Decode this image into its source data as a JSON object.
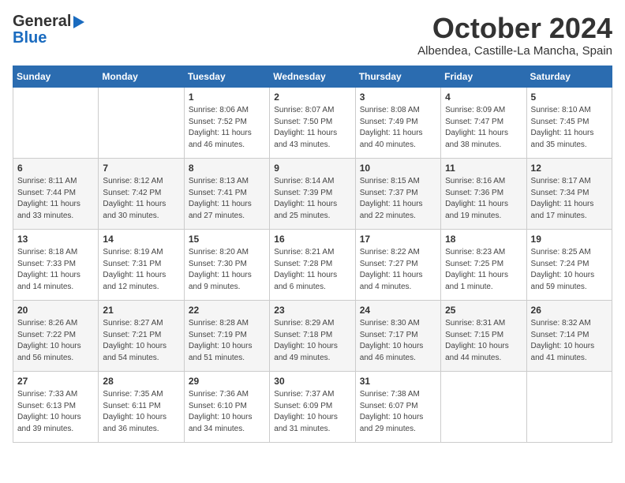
{
  "header": {
    "logo_general": "General",
    "logo_blue": "Blue",
    "month_title": "October 2024",
    "location": "Albendea, Castille-La Mancha, Spain"
  },
  "days_of_week": [
    "Sunday",
    "Monday",
    "Tuesday",
    "Wednesday",
    "Thursday",
    "Friday",
    "Saturday"
  ],
  "weeks": [
    [
      {
        "day": "",
        "info": ""
      },
      {
        "day": "",
        "info": ""
      },
      {
        "day": "1",
        "info": "Sunrise: 8:06 AM\nSunset: 7:52 PM\nDaylight: 11 hours and 46 minutes."
      },
      {
        "day": "2",
        "info": "Sunrise: 8:07 AM\nSunset: 7:50 PM\nDaylight: 11 hours and 43 minutes."
      },
      {
        "day": "3",
        "info": "Sunrise: 8:08 AM\nSunset: 7:49 PM\nDaylight: 11 hours and 40 minutes."
      },
      {
        "day": "4",
        "info": "Sunrise: 8:09 AM\nSunset: 7:47 PM\nDaylight: 11 hours and 38 minutes."
      },
      {
        "day": "5",
        "info": "Sunrise: 8:10 AM\nSunset: 7:45 PM\nDaylight: 11 hours and 35 minutes."
      }
    ],
    [
      {
        "day": "6",
        "info": "Sunrise: 8:11 AM\nSunset: 7:44 PM\nDaylight: 11 hours and 33 minutes."
      },
      {
        "day": "7",
        "info": "Sunrise: 8:12 AM\nSunset: 7:42 PM\nDaylight: 11 hours and 30 minutes."
      },
      {
        "day": "8",
        "info": "Sunrise: 8:13 AM\nSunset: 7:41 PM\nDaylight: 11 hours and 27 minutes."
      },
      {
        "day": "9",
        "info": "Sunrise: 8:14 AM\nSunset: 7:39 PM\nDaylight: 11 hours and 25 minutes."
      },
      {
        "day": "10",
        "info": "Sunrise: 8:15 AM\nSunset: 7:37 PM\nDaylight: 11 hours and 22 minutes."
      },
      {
        "day": "11",
        "info": "Sunrise: 8:16 AM\nSunset: 7:36 PM\nDaylight: 11 hours and 19 minutes."
      },
      {
        "day": "12",
        "info": "Sunrise: 8:17 AM\nSunset: 7:34 PM\nDaylight: 11 hours and 17 minutes."
      }
    ],
    [
      {
        "day": "13",
        "info": "Sunrise: 8:18 AM\nSunset: 7:33 PM\nDaylight: 11 hours and 14 minutes."
      },
      {
        "day": "14",
        "info": "Sunrise: 8:19 AM\nSunset: 7:31 PM\nDaylight: 11 hours and 12 minutes."
      },
      {
        "day": "15",
        "info": "Sunrise: 8:20 AM\nSunset: 7:30 PM\nDaylight: 11 hours and 9 minutes."
      },
      {
        "day": "16",
        "info": "Sunrise: 8:21 AM\nSunset: 7:28 PM\nDaylight: 11 hours and 6 minutes."
      },
      {
        "day": "17",
        "info": "Sunrise: 8:22 AM\nSunset: 7:27 PM\nDaylight: 11 hours and 4 minutes."
      },
      {
        "day": "18",
        "info": "Sunrise: 8:23 AM\nSunset: 7:25 PM\nDaylight: 11 hours and 1 minute."
      },
      {
        "day": "19",
        "info": "Sunrise: 8:25 AM\nSunset: 7:24 PM\nDaylight: 10 hours and 59 minutes."
      }
    ],
    [
      {
        "day": "20",
        "info": "Sunrise: 8:26 AM\nSunset: 7:22 PM\nDaylight: 10 hours and 56 minutes."
      },
      {
        "day": "21",
        "info": "Sunrise: 8:27 AM\nSunset: 7:21 PM\nDaylight: 10 hours and 54 minutes."
      },
      {
        "day": "22",
        "info": "Sunrise: 8:28 AM\nSunset: 7:19 PM\nDaylight: 10 hours and 51 minutes."
      },
      {
        "day": "23",
        "info": "Sunrise: 8:29 AM\nSunset: 7:18 PM\nDaylight: 10 hours and 49 minutes."
      },
      {
        "day": "24",
        "info": "Sunrise: 8:30 AM\nSunset: 7:17 PM\nDaylight: 10 hours and 46 minutes."
      },
      {
        "day": "25",
        "info": "Sunrise: 8:31 AM\nSunset: 7:15 PM\nDaylight: 10 hours and 44 minutes."
      },
      {
        "day": "26",
        "info": "Sunrise: 8:32 AM\nSunset: 7:14 PM\nDaylight: 10 hours and 41 minutes."
      }
    ],
    [
      {
        "day": "27",
        "info": "Sunrise: 7:33 AM\nSunset: 6:13 PM\nDaylight: 10 hours and 39 minutes."
      },
      {
        "day": "28",
        "info": "Sunrise: 7:35 AM\nSunset: 6:11 PM\nDaylight: 10 hours and 36 minutes."
      },
      {
        "day": "29",
        "info": "Sunrise: 7:36 AM\nSunset: 6:10 PM\nDaylight: 10 hours and 34 minutes."
      },
      {
        "day": "30",
        "info": "Sunrise: 7:37 AM\nSunset: 6:09 PM\nDaylight: 10 hours and 31 minutes."
      },
      {
        "day": "31",
        "info": "Sunrise: 7:38 AM\nSunset: 6:07 PM\nDaylight: 10 hours and 29 minutes."
      },
      {
        "day": "",
        "info": ""
      },
      {
        "day": "",
        "info": ""
      }
    ]
  ]
}
